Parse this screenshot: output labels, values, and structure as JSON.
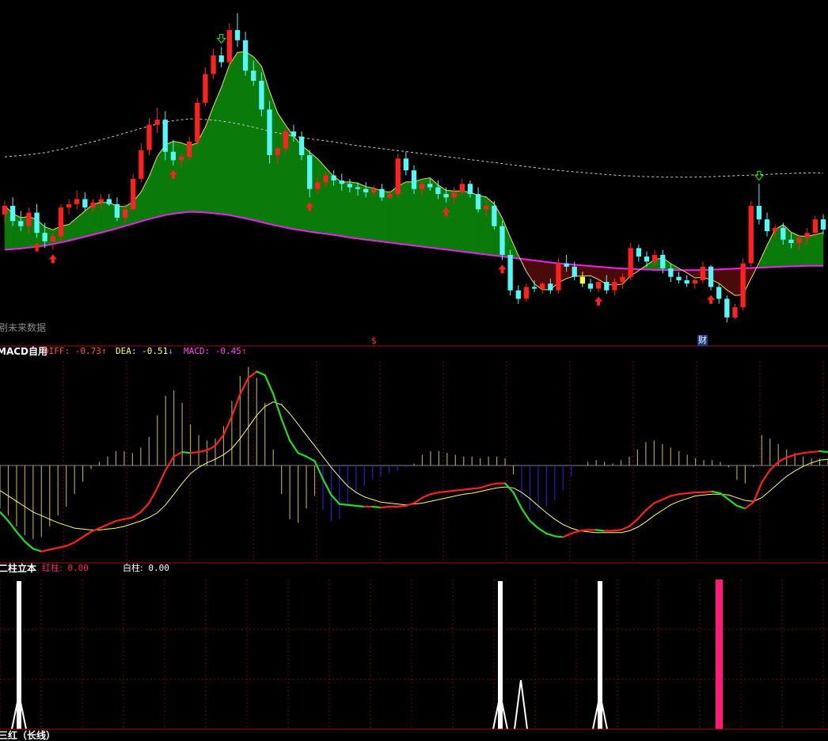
{
  "colors": {
    "background": "#000000",
    "up": "#ff2020",
    "down": "#54f8f8",
    "highlight": "#ffff30",
    "ma_long": "#ee22ee",
    "ma_short": "#e8e050",
    "cloud_bull": "#0a7a0a",
    "cloud_bear": "#4a0a0a",
    "upper_band": "#c8c8c8",
    "diff_up": "#ff2020",
    "diff_down": "#22dd22",
    "dea": "#ffff66",
    "macd_pos": "#b0a040",
    "macd_neg": "#2020cc",
    "white_bar": "#ffffff",
    "red_bar": "#ff1a7a",
    "panel_border": "#a01010"
  },
  "main_panel": {
    "watermark": "剔未来数据",
    "marker_dollar": "$",
    "marker_cai": "财"
  },
  "macd_panel": {
    "name": "MACD自用",
    "diff_label": "DIFF:",
    "diff_value": "-0.73",
    "dea_label": "DEA:",
    "dea_value": "-0.51",
    "macd_label": "MACD:",
    "macd_value": "-0.45",
    "up_arrow": "↑",
    "down_arrow": "↓"
  },
  "pillar_panel": {
    "name": "二柱立本",
    "red_label": "红柱:",
    "red_value": "0.00",
    "white_label": "白柱:",
    "white_value": "0.00"
  },
  "footer_panel": {
    "name": "三红（长线）"
  },
  "chart_data": [
    {
      "type": "candlestick",
      "title": "",
      "candles": [
        [
          100,
          100.8,
          99.5,
          100.5
        ],
        [
          100.5,
          101.0,
          99.3,
          99.6
        ],
        [
          99.6,
          100.2,
          99.0,
          99.3
        ],
        [
          99.3,
          100.4,
          98.8,
          100.1
        ],
        [
          100.1,
          100.6,
          98.6,
          98.9
        ],
        [
          98.9,
          99.5,
          98.0,
          98.4
        ],
        [
          98.4,
          98.9,
          97.9,
          98.7
        ],
        [
          98.7,
          100.6,
          98.4,
          100.4
        ],
        [
          100.4,
          100.9,
          100.0,
          100.6
        ],
        [
          100.6,
          101.4,
          100.3,
          100.9
        ],
        [
          100.9,
          101.3,
          100.2,
          100.4
        ],
        [
          100.4,
          100.9,
          100.1,
          100.7
        ],
        [
          100.7,
          101.2,
          100.3,
          100.9
        ],
        [
          100.9,
          101.2,
          100.5,
          100.6
        ],
        [
          100.6,
          101.0,
          99.6,
          99.8
        ],
        [
          99.8,
          100.6,
          99.5,
          100.3
        ],
        [
          100.3,
          102.4,
          100.2,
          102.1
        ],
        [
          102.1,
          104.2,
          101.9,
          103.8
        ],
        [
          103.8,
          105.7,
          103.5,
          105.3
        ],
        [
          105.3,
          106.3,
          104.8,
          105.6
        ],
        [
          105.6,
          106.1,
          103.2,
          103.7
        ],
        [
          103.7,
          104.4,
          102.9,
          103.2
        ],
        [
          103.2,
          103.6,
          102.7,
          103.4
        ],
        [
          103.4,
          104.6,
          103.2,
          104.3
        ],
        [
          104.3,
          106.9,
          104.1,
          106.6
        ],
        [
          106.6,
          108.7,
          106.4,
          108.3
        ],
        [
          108.3,
          109.8,
          108.0,
          109.4
        ],
        [
          109.4,
          109.9,
          108.7,
          109.0
        ],
        [
          109.0,
          111.3,
          108.8,
          110.9
        ],
        [
          110.9,
          111.9,
          109.9,
          110.3
        ],
        [
          110.3,
          110.8,
          108.2,
          108.5
        ],
        [
          108.5,
          109.1,
          107.6,
          107.9
        ],
        [
          107.9,
          108.4,
          105.8,
          106.2
        ],
        [
          106.2,
          106.7,
          103.0,
          103.5
        ],
        [
          103.5,
          104.0,
          103.0,
          103.9
        ],
        [
          103.9,
          105.1,
          103.6,
          104.9
        ],
        [
          104.9,
          105.3,
          104.3,
          104.6
        ],
        [
          104.6,
          104.9,
          103.2,
          103.5
        ],
        [
          103.5,
          103.8,
          101.0,
          101.5
        ],
        [
          101.5,
          102.2,
          101.2,
          101.9
        ],
        [
          101.9,
          102.5,
          101.6,
          102.3
        ],
        [
          102.3,
          102.6,
          101.7,
          102.0
        ],
        [
          102.0,
          102.4,
          101.4,
          101.8
        ],
        [
          101.8,
          102.1,
          101.3,
          101.6
        ],
        [
          101.6,
          101.9,
          101.1,
          101.5
        ],
        [
          101.5,
          101.9,
          101.0,
          101.3
        ],
        [
          101.3,
          101.7,
          101.1,
          101.5
        ],
        [
          101.5,
          101.8,
          100.8,
          101.0
        ],
        [
          101.0,
          101.4,
          100.9,
          101.2
        ],
        [
          101.2,
          103.6,
          101.0,
          103.3
        ],
        [
          103.3,
          103.7,
          102.3,
          102.6
        ],
        [
          102.6,
          102.9,
          101.2,
          101.5
        ],
        [
          101.5,
          102.0,
          101.1,
          101.8
        ],
        [
          101.8,
          102.1,
          101.4,
          101.6
        ],
        [
          101.6,
          102.0,
          100.9,
          101.2
        ],
        [
          101.2,
          101.6,
          100.7,
          101.0
        ],
        [
          101.0,
          101.6,
          100.6,
          101.3
        ],
        [
          101.3,
          102.1,
          101.1,
          101.8
        ],
        [
          101.8,
          102.0,
          101.0,
          101.2
        ],
        [
          101.2,
          101.6,
          100.1,
          100.3
        ],
        [
          100.3,
          100.8,
          99.9,
          100.5
        ],
        [
          100.5,
          100.8,
          99.1,
          99.3
        ],
        [
          99.3,
          99.6,
          97.3,
          97.6
        ],
        [
          97.6,
          97.9,
          95.2,
          95.5
        ],
        [
          95.5,
          95.8,
          94.7,
          95.0
        ],
        [
          95.0,
          95.9,
          94.8,
          95.7
        ],
        [
          95.7,
          96.1,
          95.4,
          95.6
        ],
        [
          95.6,
          96.0,
          95.3,
          95.9
        ],
        [
          95.9,
          96.2,
          95.3,
          95.5
        ],
        [
          95.5,
          97.4,
          95.3,
          97.1
        ],
        [
          97.1,
          97.6,
          96.6,
          96.9
        ],
        [
          96.9,
          97.2,
          96.1,
          96.3
        ],
        [
          96.3,
          96.6,
          95.7,
          95.9
        ],
        [
          95.9,
          96.2,
          95.4,
          95.6
        ],
        [
          95.6,
          96.2,
          95.4,
          96.0
        ],
        [
          96.0,
          96.4,
          95.3,
          95.5
        ],
        [
          95.5,
          96.2,
          95.2,
          96.0
        ],
        [
          96.0,
          96.5,
          95.6,
          96.3
        ],
        [
          96.3,
          98.3,
          96.1,
          98.0
        ],
        [
          98.0,
          98.2,
          97.2,
          97.5
        ],
        [
          97.5,
          97.8,
          96.9,
          97.2
        ],
        [
          97.2,
          97.9,
          96.9,
          97.6
        ],
        [
          97.6,
          97.9,
          96.5,
          96.8
        ],
        [
          96.8,
          97.1,
          96.0,
          96.3
        ],
        [
          96.3,
          96.6,
          95.9,
          96.1
        ],
        [
          96.1,
          96.4,
          95.7,
          95.9
        ],
        [
          95.9,
          96.3,
          95.6,
          96.1
        ],
        [
          96.1,
          97.2,
          95.9,
          96.9
        ],
        [
          96.9,
          97.0,
          95.5,
          95.7
        ],
        [
          95.7,
          95.9,
          94.7,
          95.0
        ],
        [
          95.0,
          95.2,
          93.6,
          93.9
        ],
        [
          93.9,
          94.7,
          93.8,
          94.5
        ],
        [
          94.5,
          97.4,
          94.3,
          97.1
        ],
        [
          97.1,
          100.8,
          96.9,
          100.5
        ],
        [
          100.5,
          101.8,
          99.4,
          99.7
        ],
        [
          99.7,
          100.1,
          98.7,
          99.0
        ],
        [
          99.0,
          99.4,
          98.6,
          99.2
        ],
        [
          99.2,
          99.5,
          98.2,
          98.5
        ],
        [
          98.5,
          98.9,
          98.0,
          98.3
        ],
        [
          98.3,
          98.8,
          97.9,
          98.6
        ],
        [
          98.6,
          99.2,
          98.2,
          98.9
        ],
        [
          98.9,
          99.9,
          98.6,
          99.7
        ],
        [
          99.7,
          100.0,
          98.8,
          99.1
        ]
      ],
      "ma_long": [
        97.9,
        98.0,
        98.15,
        98.4,
        98.7,
        99.0,
        99.35,
        99.7,
        100.0,
        100.15,
        100.1,
        99.95,
        99.7,
        99.4,
        99.15,
        98.95,
        98.8,
        98.6,
        98.45,
        98.3,
        98.15,
        98.0,
        97.85,
        97.7,
        97.55,
        97.4,
        97.25,
        97.1,
        97.0,
        96.9,
        96.8,
        96.75,
        96.7,
        96.7,
        96.7,
        96.75,
        96.8,
        96.85,
        96.9,
        96.95,
        96.95
      ],
      "diff": [
        -0.52,
        -0.62,
        -0.74,
        -0.85,
        -0.93,
        -0.96,
        -0.94,
        -0.92,
        -0.9,
        -0.86,
        -0.8,
        -0.74,
        -0.7,
        -0.66,
        -0.62,
        -0.6,
        -0.58,
        -0.52,
        -0.42,
        -0.25,
        -0.05,
        0.1,
        0.15,
        0.14,
        0.15,
        0.17,
        0.22,
        0.34,
        0.55,
        0.8,
        0.98,
        1.05,
        1.01,
        0.8,
        0.52,
        0.28,
        0.14,
        0.1,
        0.05,
        -0.15,
        -0.33,
        -0.43,
        -0.44,
        -0.45,
        -0.46,
        -0.46,
        -0.47,
        -0.46,
        -0.46,
        -0.45,
        -0.42,
        -0.36,
        -0.32,
        -0.3,
        -0.29,
        -0.28,
        -0.27,
        -0.26,
        -0.25,
        -0.22,
        -0.2,
        -0.2,
        -0.3,
        -0.48,
        -0.62,
        -0.7,
        -0.76,
        -0.79,
        -0.8,
        -0.76,
        -0.73,
        -0.72,
        -0.72,
        -0.73,
        -0.73,
        -0.72,
        -0.68,
        -0.6,
        -0.5,
        -0.42,
        -0.38,
        -0.34,
        -0.32,
        -0.31,
        -0.3,
        -0.3,
        -0.29,
        -0.31,
        -0.38,
        -0.45,
        -0.48,
        -0.41,
        -0.19,
        -0.05,
        0.04,
        0.09,
        0.12,
        0.14,
        0.15,
        0.16,
        0.15
      ],
      "dea": [
        -0.28,
        -0.34,
        -0.4,
        -0.46,
        -0.52,
        -0.56,
        -0.6,
        -0.64,
        -0.67,
        -0.7,
        -0.71,
        -0.72,
        -0.72,
        -0.71,
        -0.7,
        -0.68,
        -0.65,
        -0.62,
        -0.58,
        -0.53,
        -0.44,
        -0.32,
        -0.2,
        -0.09,
        -0.02,
        0.03,
        0.07,
        0.12,
        0.19,
        0.3,
        0.43,
        0.56,
        0.66,
        0.71,
        0.68,
        0.58,
        0.46,
        0.34,
        0.22,
        0.1,
        -0.02,
        -0.13,
        -0.23,
        -0.3,
        -0.35,
        -0.38,
        -0.41,
        -0.42,
        -0.43,
        -0.44,
        -0.43,
        -0.42,
        -0.4,
        -0.38,
        -0.36,
        -0.34,
        -0.32,
        -0.31,
        -0.29,
        -0.27,
        -0.25,
        -0.24,
        -0.25,
        -0.3,
        -0.37,
        -0.45,
        -0.53,
        -0.6,
        -0.66,
        -0.7,
        -0.73,
        -0.74,
        -0.75,
        -0.75,
        -0.75,
        -0.75,
        -0.73,
        -0.69,
        -0.63,
        -0.56,
        -0.5,
        -0.44,
        -0.4,
        -0.37,
        -0.34,
        -0.33,
        -0.32,
        -0.32,
        -0.33,
        -0.36,
        -0.39,
        -0.4,
        -0.36,
        -0.28,
        -0.2,
        -0.12,
        -0.06,
        -0.01,
        0.03,
        0.06,
        0.07
      ],
      "macd": [
        -0.48,
        -0.56,
        -0.68,
        -0.78,
        -0.82,
        -0.8,
        -0.68,
        -0.56,
        -0.46,
        -0.32,
        -0.18,
        -0.04,
        0.04,
        0.1,
        0.16,
        0.16,
        0.14,
        0.2,
        0.32,
        0.56,
        0.78,
        0.84,
        0.7,
        0.46,
        0.34,
        0.28,
        0.3,
        0.44,
        0.72,
        1.0,
        1.1,
        0.98,
        0.7,
        0.18,
        -0.32,
        -0.6,
        -0.64,
        -0.48,
        -0.34,
        -0.5,
        -0.62,
        -0.6,
        -0.42,
        -0.3,
        -0.22,
        -0.16,
        -0.12,
        -0.08,
        -0.06,
        -0.02,
        0.02,
        0.12,
        0.16,
        0.16,
        0.14,
        0.12,
        0.1,
        0.1,
        0.08,
        0.1,
        0.1,
        0.08,
        -0.1,
        -0.36,
        -0.5,
        -0.5,
        -0.46,
        -0.38,
        -0.28,
        -0.12,
        0.0,
        0.04,
        0.06,
        0.04,
        0.02,
        0.06,
        0.1,
        0.18,
        0.26,
        0.28,
        0.24,
        0.2,
        0.16,
        0.12,
        0.08,
        0.06,
        0.06,
        0.04,
        -0.02,
        -0.16,
        -0.2,
        -0.02,
        0.34,
        0.3,
        0.24,
        0.18,
        0.14,
        0.1,
        0.08,
        0.08,
        0.06
      ],
      "white_pillars": [
        7,
        64,
        79
      ],
      "red_pillars": [
        90
      ],
      "x": [],
      "ylabel": ""
    }
  ]
}
